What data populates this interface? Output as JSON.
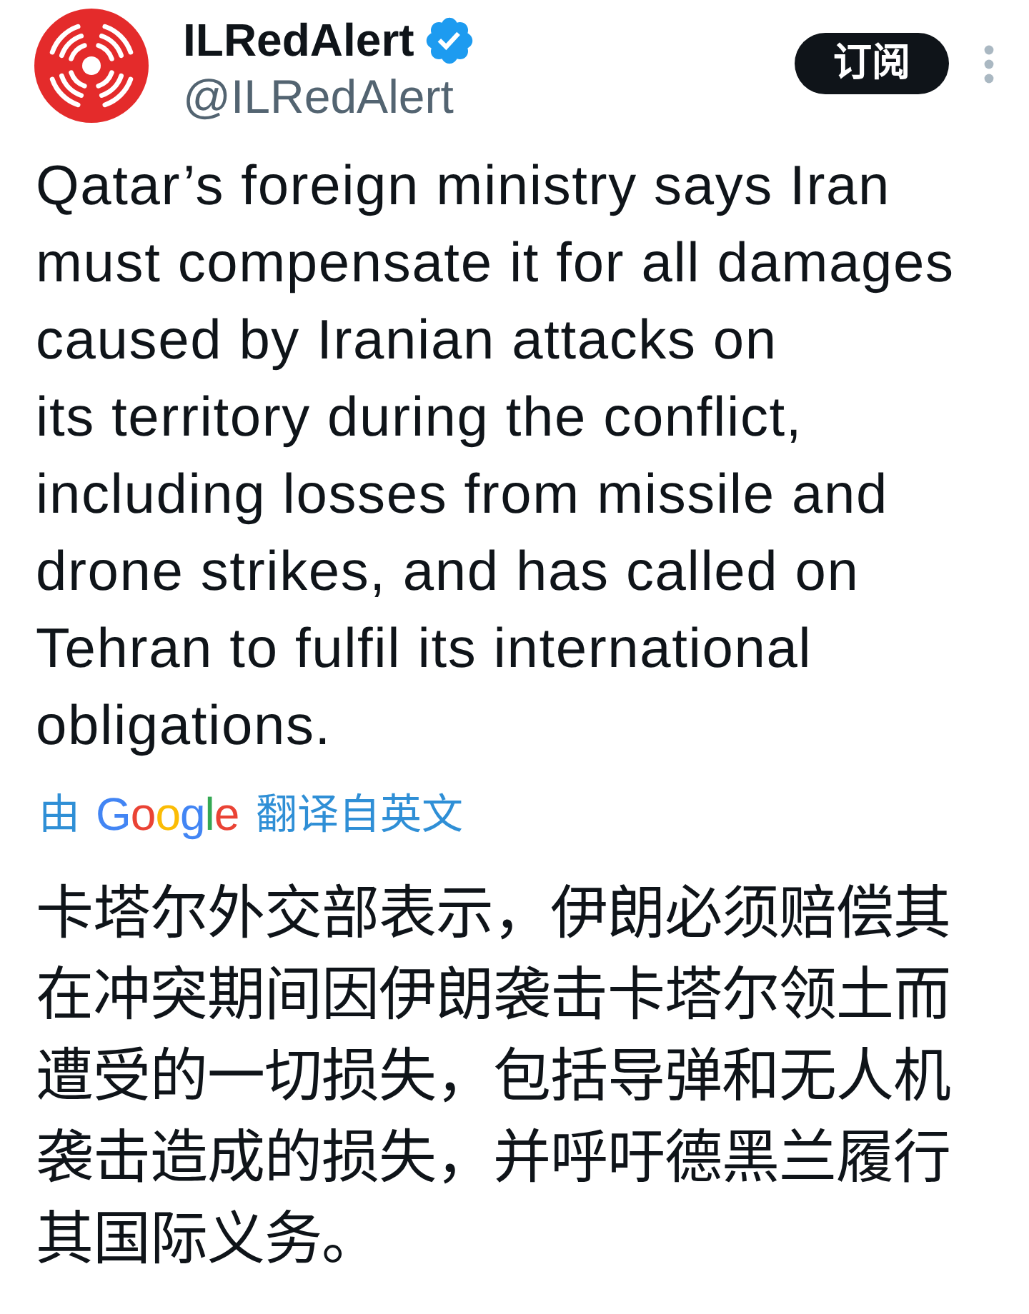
{
  "account": {
    "display_name": "ILRedAlert",
    "verified": true,
    "handle": "@ILRedAlert"
  },
  "subscribe_button": {
    "label": "订阅"
  },
  "tweet": {
    "text": "Qatar’s foreign ministry says Iran\nmust compensate it for all damages\ncaused by Iranian attacks on\nits territory during the conflict,\nincluding losses from missile and\ndrone strikes, and has called on\nTehran to fulfil its international\nobligations.",
    "translation_note": {
      "prefix": "由",
      "brand": "Google",
      "suffix": "翻译自英文"
    },
    "translated_text": "卡塔尔外交部表示，伊朗必须赔偿其在冲突期间因伊朗袭击卡塔尔领土而遭受的一切损失，包括导弹和无人机袭击造成的损失，并呼吁德黑兰履行其国际义务。"
  }
}
